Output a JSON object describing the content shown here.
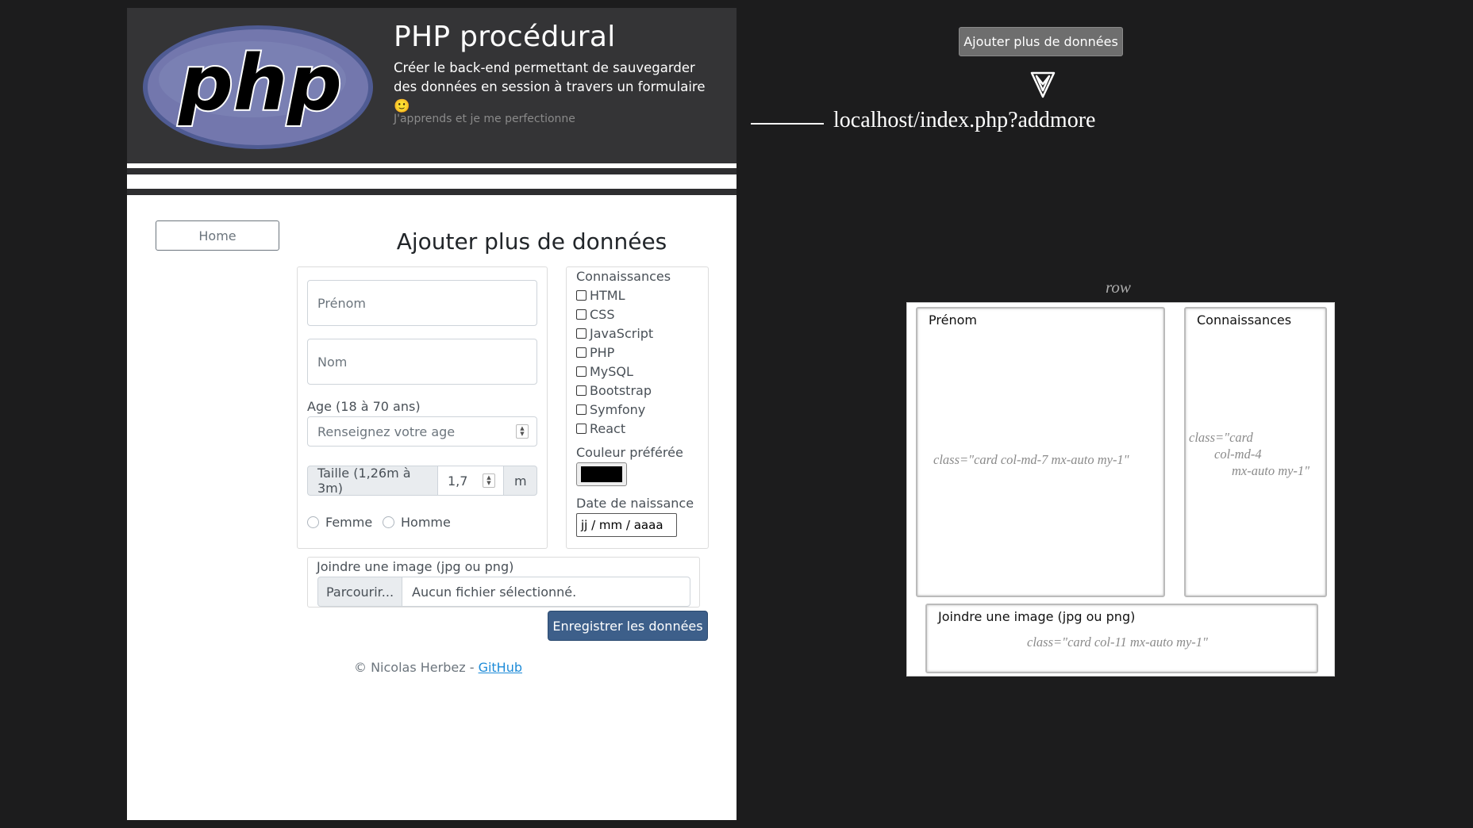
{
  "hero": {
    "title": "PHP procédural",
    "lead": "Créer le back-end permettant de sauvegarder des données en session à travers un formulaire 🙂",
    "small": "J'apprends et je me perfectionne",
    "logo_text": "php"
  },
  "nav": {
    "home_label": "Home"
  },
  "page": {
    "title": "Ajouter plus de données"
  },
  "form": {
    "prenom_placeholder": "Prénom",
    "nom_placeholder": "Nom",
    "age_label": "Age (18 à 70 ans)",
    "age_placeholder": "Renseignez votre age",
    "taille_label": "Taille (1,26m à 3m)",
    "taille_value": "1,7",
    "taille_unit": "m",
    "gender_options": [
      "Femme",
      "Homme"
    ],
    "knowledge_title": "Connaissances",
    "knowledge_items": [
      "HTML",
      "CSS",
      "JavaScript",
      "PHP",
      "MySQL",
      "Bootstrap",
      "Symfony",
      "React"
    ],
    "color_label": "Couleur préférée",
    "color_value": "#000000",
    "birth_label": "Date de naissance",
    "birth_placeholder": "jj / mm / aaaa",
    "image_label": "Joindre une image (jpg ou png)",
    "browse_label": "Parcourir...",
    "no_file_label": "Aucun fichier sélectionné.",
    "save_label": "Enregistrer les données"
  },
  "footer": {
    "copy": "© Nicolas Herbez - ",
    "link": "GitHub"
  },
  "annotation": {
    "button_label": "Ajouter plus de données",
    "url": "localhost/index.php?addmore",
    "row_label": "row",
    "box1_title": "Prénom",
    "box1_class": "class=\"card col-md-7 mx-auto my-1\"",
    "box2_title": "Connaissances",
    "box2_class_l1": "class=\"card",
    "box2_class_l2": "col-md-4",
    "box2_class_l3": "mx-auto my-1\"",
    "box3_title": "Joindre une image (jpg ou png)",
    "box3_class": "class=\"card col-11 mx-auto my-1\""
  },
  "colors": {
    "hero_bg": "#343436",
    "primary_btn": "#3d5f8a",
    "php_logo": "#7377ad",
    "page_bg": "#1c1c1d"
  }
}
